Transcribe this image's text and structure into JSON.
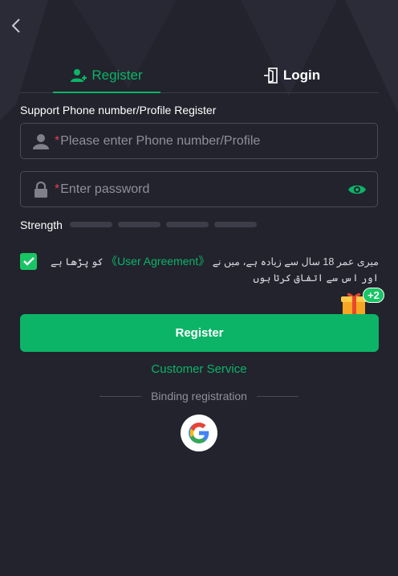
{
  "tabs": {
    "register_label": "Register",
    "login_label": "Login"
  },
  "form": {
    "section_label": "Support Phone number/Profile Register",
    "phone_placeholder": "Please enter Phone number/Profile",
    "password_placeholder": "Enter password",
    "required_mark": "*",
    "strength_label": "Strength"
  },
  "agreement": {
    "text_before": "میری عمر 18 سال سے زیادہ ہے، میں نے",
    "link_text": "《User Agreement》",
    "text_after": "کو پڑھا ہے اور اس سے اتفاق کرتا ہوں",
    "checked": true
  },
  "gift": {
    "badge": "+2"
  },
  "actions": {
    "register_button": "Register",
    "customer_service": "Customer Service",
    "binding_label": "Binding registration"
  },
  "colors": {
    "background": "#22232d",
    "accent": "#0cb467",
    "error_star": "#e0424c"
  },
  "icons": {
    "back": "chevron-left-icon",
    "register_tab": "user-plus-icon",
    "login_tab": "door-login-icon",
    "phone_field": "user-icon",
    "password_field": "lock-icon",
    "password_toggle": "eye-icon",
    "checkbox": "check-icon",
    "gift": "gift-icon",
    "social": "google-icon"
  }
}
